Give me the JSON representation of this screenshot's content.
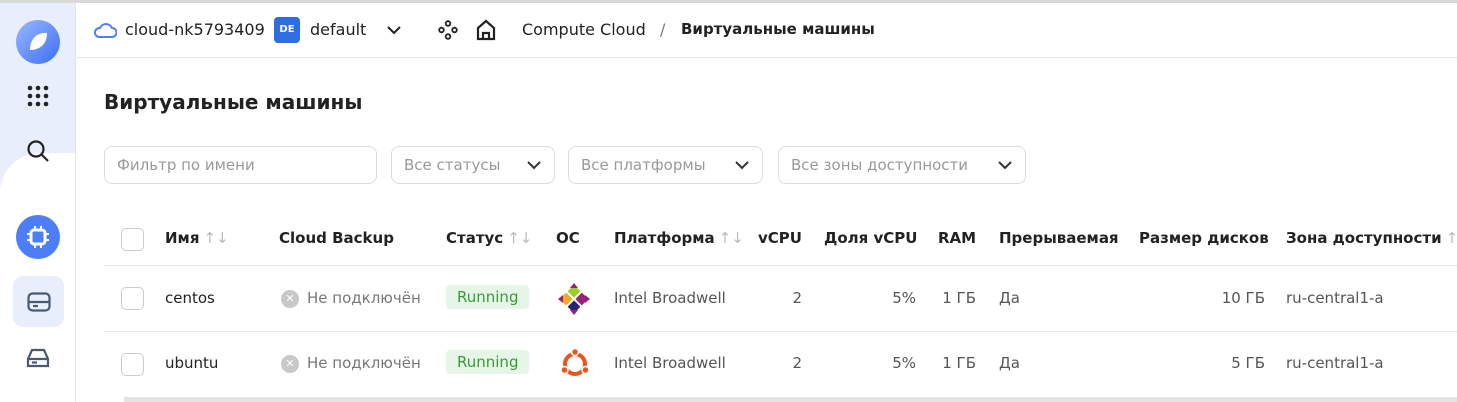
{
  "header": {
    "cloud": "cloud-nk5793409",
    "folder_badge": "DE",
    "folder": "default",
    "breadcrumb": [
      "Compute Cloud",
      "Виртуальные машины"
    ],
    "separator": "/"
  },
  "page": {
    "title": "Виртуальные машины"
  },
  "filters": {
    "name_placeholder": "Фильтр по имени",
    "status": "Все статусы",
    "platform": "Все платформы",
    "zone": "Все зоны доступности"
  },
  "table": {
    "columns": [
      "Имя",
      "Cloud Backup",
      "Статус",
      "ОС",
      "Платформа",
      "vCPU",
      "Доля vCPU",
      "RAM",
      "Прерываемая",
      "Размер дисков",
      "Зона доступности"
    ],
    "sort_icon": "↑↓",
    "rows": [
      {
        "name": "centos",
        "backup": "Не подключён",
        "status": "Running",
        "os": "centos",
        "platform": "Intel Broadwell",
        "vcpu": "2",
        "share": "5%",
        "ram": "1 ГБ",
        "preemptible": "Да",
        "disk": "10 ГБ",
        "zone": "ru-central1-a"
      },
      {
        "name": "ubuntu",
        "backup": "Не подключён",
        "status": "Running",
        "os": "ubuntu",
        "platform": "Intel Broadwell",
        "vcpu": "2",
        "share": "5%",
        "ram": "1 ГБ",
        "preemptible": "Да",
        "disk": "5 ГБ",
        "zone": "ru-central1-a"
      }
    ]
  },
  "colors": {
    "accent": "#4d7ef7",
    "running_bg": "#e6f6e6",
    "running_text": "#3a9a3a",
    "sidebar_bg": "#e8eefc"
  }
}
